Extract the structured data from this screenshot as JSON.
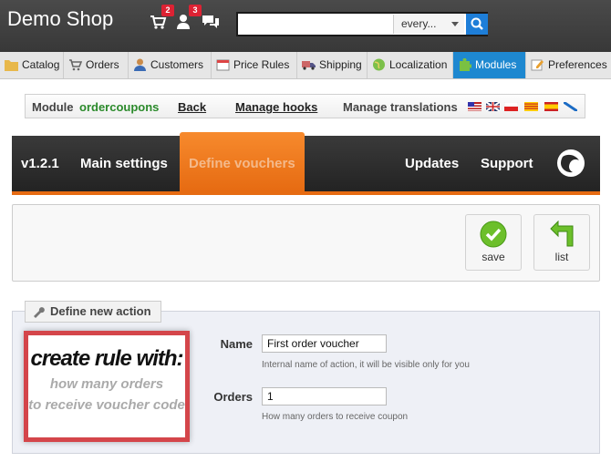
{
  "header": {
    "logo": "Demo Shop",
    "cart_badge": "2",
    "customers_badge": "3",
    "search": {
      "value": "",
      "scope": "every..."
    }
  },
  "tabs": [
    {
      "label": "Catalog"
    },
    {
      "label": "Orders"
    },
    {
      "label": "Customers"
    },
    {
      "label": "Price Rules"
    },
    {
      "label": "Shipping"
    },
    {
      "label": "Localization"
    },
    {
      "label": "Modules"
    },
    {
      "label": "Preferences"
    }
  ],
  "module_bar": {
    "module_label": "Module",
    "module_name": "ordercoupons",
    "back": "Back",
    "manage_hooks": "Manage hooks",
    "manage_translations": "Manage translations"
  },
  "module_nav": {
    "version": "v1.2.1",
    "main_settings": "Main settings",
    "define_vouchers": "Define vouchers",
    "updates": "Updates",
    "support": "Support"
  },
  "toolbar": {
    "save": "save",
    "list": "list"
  },
  "form": {
    "legend": "Define new action",
    "promo_title": "create rule with:",
    "promo_line1": "how many orders",
    "promo_line2": "to receive voucher code",
    "name_label": "Name",
    "name_value": "First order voucher",
    "name_help": "Internal name of action, it will be visible only for you",
    "orders_label": "Orders",
    "orders_value": "1",
    "orders_help": "How many orders to receive coupon"
  },
  "colors": {
    "accent_orange": "#e66b12",
    "active_tab_blue": "#1e88d0",
    "module_green": "#2b8a2b"
  }
}
